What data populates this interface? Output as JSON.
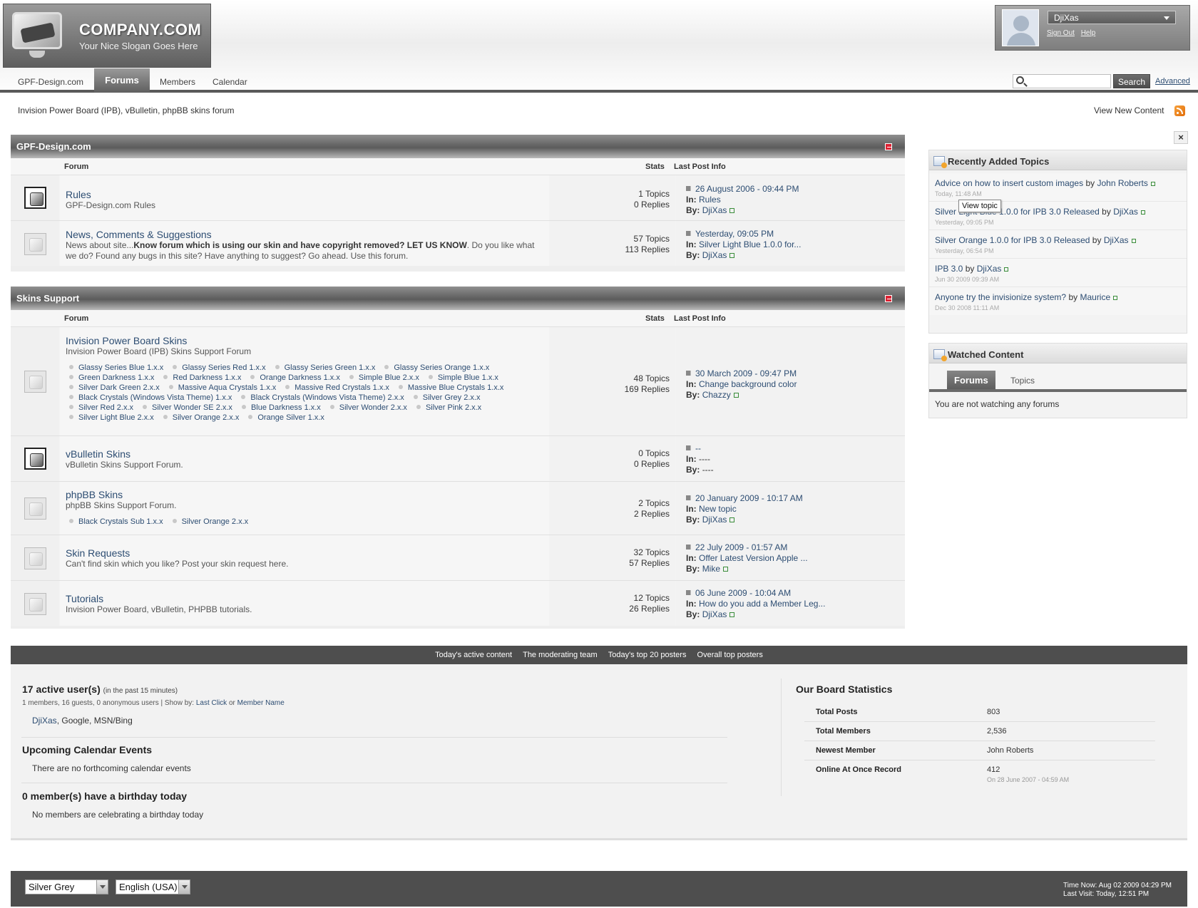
{
  "logo": {
    "title": "COMPANY.COM",
    "slogan": "Your Nice Slogan Goes Here"
  },
  "user": {
    "name": "DjiXas",
    "sign_out": "Sign Out",
    "help": "Help"
  },
  "nav": {
    "tabs": [
      "GPF-Design.com",
      "Forums",
      "Members",
      "Calendar"
    ],
    "active": "Forums"
  },
  "search": {
    "value": "",
    "button": "Search",
    "advanced": "Advanced"
  },
  "breadcrumb": "Invision Power Board (IPB), vBulletin, phpBB skins forum",
  "view_new_content": "View New Content",
  "columns": {
    "forum": "Forum",
    "stats": "Stats",
    "last": "Last Post Info"
  },
  "labels": {
    "in": "In:",
    "by": "By:"
  },
  "categories": [
    {
      "title": "GPF-Design.com",
      "forums": [
        {
          "title": "Rules",
          "desc": "GPF-Design.com Rules",
          "topics": "1 Topics",
          "replies": "0 Replies",
          "date": "26 August 2006 - 09:44 PM",
          "in": "Rules",
          "by": "DjiXas"
        },
        {
          "title": "News, Comments & Suggestions",
          "desc_a": "News about site...",
          "desc_b": "Know forum which is using our skin and have copyright removed? LET US KNOW",
          "desc_c": ". Do you like what we do? Found any bugs in this site? Have anything to suggest? Go ahead. Use this forum.",
          "topics": "57 Topics",
          "replies": "113 Replies",
          "date": "Yesterday, 09:05 PM",
          "in": "Silver Light Blue 1.0.0 for...",
          "by": "DjiXas"
        }
      ]
    },
    {
      "title": "Skins Support",
      "forums": [
        {
          "title": "Invision Power Board Skins",
          "desc": "Invision Power Board (IPB) Skins Support Forum",
          "subforums": [
            "Glassy Series Blue 1.x.x",
            "Glassy Series Red 1.x.x",
            "Glassy Series Green 1.x.x",
            "Glassy Series Orange 1.x.x",
            "Green Darkness 1.x.x",
            "Red Darkness 1.x.x",
            "Orange Darkness 1.x.x",
            "Simple Blue 2.x.x",
            "Simple Blue 1.x.x",
            "Silver Dark Green 2.x.x",
            "Massive Aqua Crystals 1.x.x",
            "Massive Red Crystals 1.x.x",
            "Massive Blue Crystals 1.x.x",
            "Black Crystals (Windows Vista Theme) 1.x.x",
            "Black Crystals (Windows Vista Theme) 2.x.x",
            "Silver Grey 2.x.x",
            "Silver Red 2.x.x",
            "Silver Wonder SE 2.x.x",
            "Blue Darkness 1.x.x",
            "Silver Wonder 2.x.x",
            "Silver Pink 2.x.x",
            "Silver Light Blue 2.x.x",
            "Silver Orange 2.x.x",
            "Orange Silver 1.x.x"
          ],
          "topics": "48 Topics",
          "replies": "169 Replies",
          "date": "30 March 2009 - 09:47 PM",
          "in": "Change background color",
          "by": "Chazzy"
        },
        {
          "title": "vBulletin Skins",
          "desc": "vBulletin Skins Support Forum.",
          "topics": "0 Topics",
          "replies": "0 Replies",
          "date": "--",
          "in": "----",
          "by": "----"
        },
        {
          "title": "phpBB Skins",
          "desc": "phpBB Skins Support Forum.",
          "subforums": [
            "Black Crystals Sub 1.x.x",
            "Silver Orange 2.x.x"
          ],
          "topics": "2 Topics",
          "replies": "2 Replies",
          "date": "20 January 2009 - 10:17 AM",
          "in": "New topic",
          "by": "DjiXas"
        },
        {
          "title": "Skin Requests",
          "desc": "Can't find skin which you like? Post your skin request here.",
          "topics": "32 Topics",
          "replies": "57 Replies",
          "date": "22 July 2009 - 01:57 AM",
          "in": "Offer Latest Version Apple ...",
          "by": "Mike"
        },
        {
          "title": "Tutorials",
          "desc": "Invision Power Board, vBulletin, PHPBB tutorials.",
          "topics": "12 Topics",
          "replies": "26 Replies",
          "date": "06 June 2009 - 10:04 AM",
          "in": "How do you add a Member Leg...",
          "by": "DjiXas"
        }
      ]
    }
  ],
  "sidebar": {
    "close": "×",
    "recent": {
      "title": "Recently Added Topics",
      "by_word": "by",
      "topics": [
        {
          "title": "Advice on how to insert custom images",
          "by": "John Roberts",
          "date": "Today, 11:48 AM"
        },
        {
          "title": "Silver Light Blue 1.0.0 for IPB 3.0 Released",
          "by": "DjiXas",
          "date": "Yesterday, 09:05 PM"
        },
        {
          "title": "Silver Orange 1.0.0 for IPB 3.0 Released",
          "by": "DjiXas",
          "date": "Yesterday, 06:54 PM"
        },
        {
          "title": "IPB 3.0",
          "by": "DjiXas",
          "date": "Jun 30 2009 09:39 AM"
        },
        {
          "title": "Anyone try the invisionize system?",
          "by": "Maurice",
          "date": "Dec 30 2008 11:11 AM"
        }
      ]
    },
    "tooltip": "View topic",
    "watched": {
      "title": "Watched Content",
      "tabs": [
        "Forums",
        "Topics"
      ],
      "empty": "You are not watching any forums"
    }
  },
  "statsbar": [
    "Today's active content",
    "The moderating team",
    "Today's top 20 posters",
    "Overall top posters"
  ],
  "active_users": {
    "title": "17 active user(s)",
    "subtitle": "(in the past 15 minutes)",
    "summary": "1 members, 16 guests, 0 anonymous users | Show by: ",
    "show_by_last": "Last Click",
    "or": " or ",
    "show_by_name": "Member Name",
    "member": "DjiXas",
    "others": ", Google, MSN/Bing"
  },
  "calendar": {
    "title": "Upcoming Calendar Events",
    "text": "There are no forthcoming calendar events"
  },
  "birthdays": {
    "title": "0 member(s) have a birthday today",
    "text": "No members are celebrating a birthday today"
  },
  "board_stats": {
    "title": "Our Board Statistics",
    "rows": [
      {
        "k": "Total Posts",
        "v": "803"
      },
      {
        "k": "Total Members",
        "v": "2,536"
      },
      {
        "k": "Newest Member",
        "v": "John Roberts"
      },
      {
        "k": "Online At Once Record",
        "v": "412",
        "v2": "On 28 June 2007 - 04:59 AM"
      }
    ]
  },
  "footer": {
    "skin": "Silver Grey",
    "language": "English (USA)",
    "time_now": "Time Now: Aug 02 2009 04:29 PM",
    "last_visit": "Last Visit: Today, 12:51 PM"
  }
}
